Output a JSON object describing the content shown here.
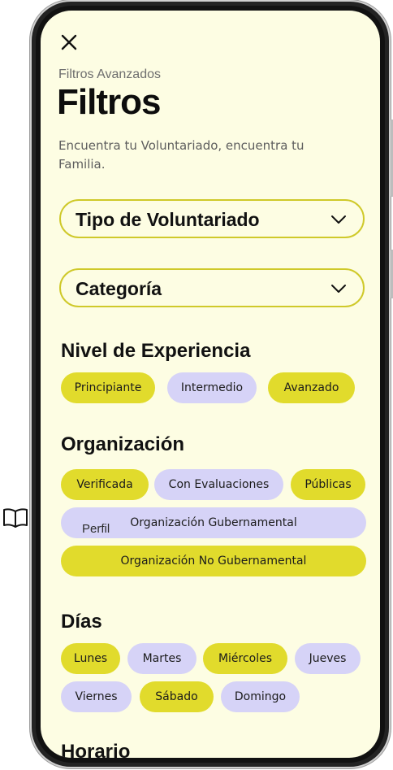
{
  "side": {
    "book_icon": "open-book-icon"
  },
  "header": {
    "close_icon": "close-icon",
    "subtitle": "Filtros Avanzados",
    "title": "Filtros",
    "description": "Encuentra tu Voluntariado, encuentra tu Familia."
  },
  "dropdowns": {
    "tipo": "Tipo de Voluntariado",
    "categoria": "Categoría"
  },
  "experience": {
    "title": "Nivel de Experiencia",
    "chips": [
      "Principiante",
      "Intermedio",
      "Avanzado"
    ]
  },
  "organization": {
    "title": "Organización",
    "chips": [
      "Verificada",
      "Con Evaluaciones",
      "Públicas",
      "Organización Gubernamental",
      "Organización No Gubernamental"
    ],
    "tooltip": "Perfil"
  },
  "days": {
    "title": "Días",
    "chips": [
      "Lunes",
      "Martes",
      "Miércoles",
      "Jueves",
      "Viernes",
      "Sábado",
      "Domingo"
    ]
  },
  "schedule": {
    "title": "Horario"
  },
  "colors": {
    "screen_bg": "#fdfde3",
    "chip_yellow": "#e1db2c",
    "chip_lilac": "#d6d3f7",
    "dropdown_border": "#cfc92a"
  }
}
